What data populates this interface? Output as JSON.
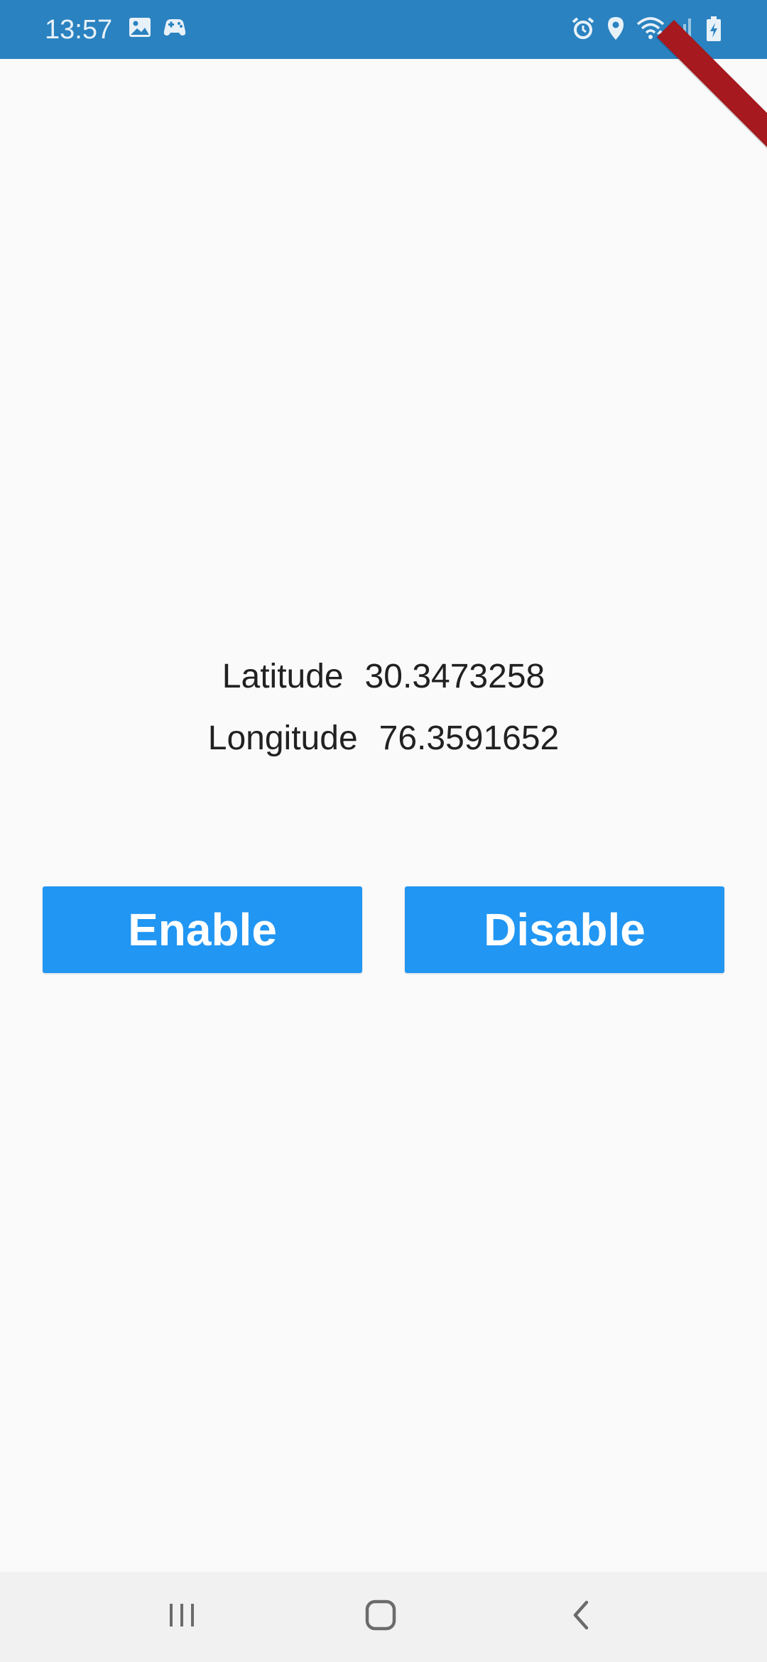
{
  "status_bar": {
    "time": "13:57",
    "background_color": "#2a82c0",
    "left_icons": [
      "image-icon",
      "game-controller-icon"
    ],
    "right_icons": [
      "alarm-icon",
      "location-pin-icon",
      "wifi-icon",
      "signal-icon",
      "battery-charging-icon"
    ]
  },
  "coordinates": {
    "latitude_label": "Latitude",
    "latitude_value": "30.3473258",
    "longitude_label": "Longitude",
    "longitude_value": "76.3591652"
  },
  "buttons": {
    "enable_label": "Enable",
    "disable_label": "Disable",
    "color": "#2196f3"
  },
  "nav_bar": {
    "icons": [
      "recents-icon",
      "home-icon",
      "back-icon"
    ]
  },
  "debug_banner": {
    "color": "#a6191e"
  }
}
